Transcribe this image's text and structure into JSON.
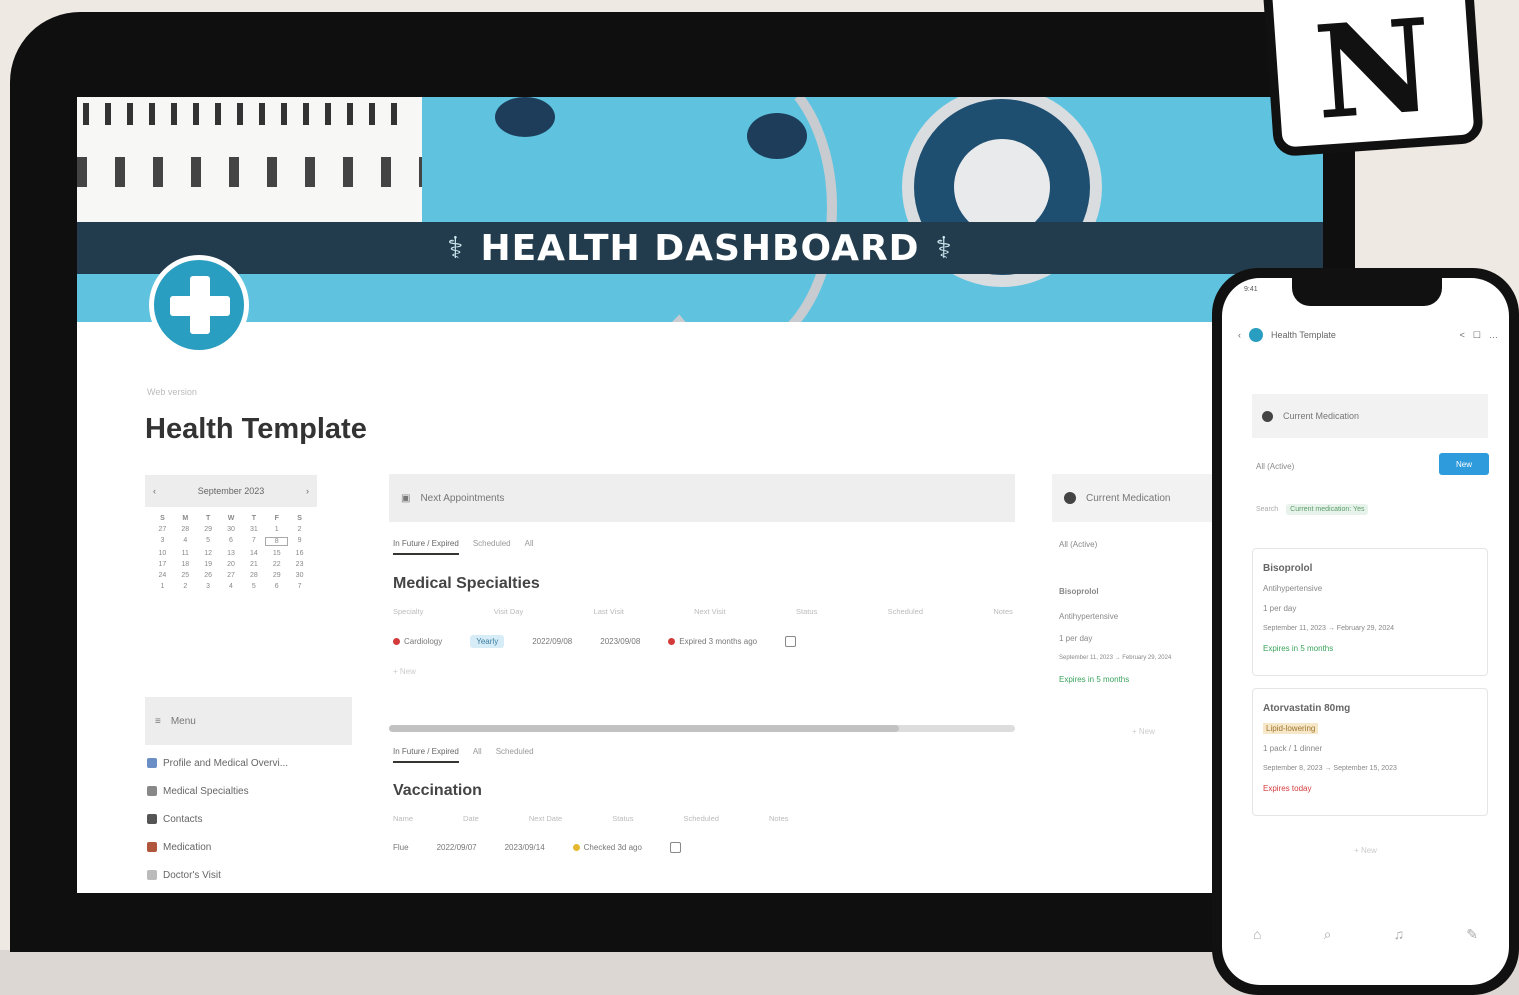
{
  "banner": {
    "title": "HEALTH DASHBOARD"
  },
  "breadcrumb": "Web version",
  "page_title": "Health Template",
  "calendar": {
    "month": "September 2023",
    "weekdays": [
      "S",
      "M",
      "T",
      "W",
      "T",
      "F",
      "S"
    ],
    "days": [
      "27",
      "28",
      "29",
      "30",
      "31",
      "1",
      "2",
      "3",
      "4",
      "5",
      "6",
      "7",
      "8",
      "9",
      "10",
      "11",
      "12",
      "13",
      "14",
      "15",
      "16",
      "17",
      "18",
      "19",
      "20",
      "21",
      "22",
      "23",
      "24",
      "25",
      "26",
      "27",
      "28",
      "29",
      "30",
      "1",
      "2",
      "3",
      "4",
      "5",
      "6",
      "7"
    ]
  },
  "menu": {
    "title": "Menu",
    "items": [
      "Profile and Medical Overvi...",
      "Medical Specialties",
      "Contacts",
      "Medication",
      "Doctor's Visit"
    ]
  },
  "appointments": {
    "title": "Next Appointments"
  },
  "medical": {
    "tabs": [
      "In Future / Expired",
      "Scheduled",
      "All"
    ],
    "title": "Medical Specialties",
    "props": [
      "Specialty",
      "Visit Day",
      "Last Visit",
      "Next Visit",
      "Status",
      "Scheduled",
      "Notes"
    ],
    "row": {
      "name": "Cardiology",
      "tag": "Yearly",
      "last": "2022/09/08",
      "next": "2023/09/08",
      "status": "Expired 3 months ago"
    },
    "new_label": "+ New"
  },
  "vaccination": {
    "tabs": [
      "In Future / Expired",
      "All",
      "Scheduled"
    ],
    "title": "Vaccination",
    "props": [
      "Name",
      "Date",
      "Next Date",
      "Status",
      "Scheduled",
      "Notes"
    ],
    "row": {
      "name": "Flue",
      "date": "2022/09/07",
      "next": "2023/09/14",
      "status": "Checked 3d ago"
    }
  },
  "medication": {
    "title": "Current Medication",
    "view": "All (Active)",
    "item": "Bisoprolol",
    "type": "Antihypertensive",
    "dose": "1 per day",
    "dates": "September 11, 2023 → February 29, 2024",
    "status": "Expires in 5 months",
    "new_label": "+ New"
  },
  "phone": {
    "time": "9:41",
    "nav_title": "Health Template",
    "medication_title": "Current Medication",
    "view": "All (Active)",
    "new_button": "New",
    "search_label": "Search",
    "search_chip": "Current medication: Yes",
    "cards": [
      {
        "title": "Bisoprolol",
        "tag": "Antihypertensive",
        "dose": "1 per day",
        "dates": "September 11, 2023 → February 29, 2024",
        "status": "Expires in 5 months"
      },
      {
        "title": "Atorvastatin 80mg",
        "tag": "Lipid-lowering",
        "dose": "1 pack / 1 dinner",
        "dates": "September 8, 2023 → September 15, 2023",
        "status": "Expires today"
      }
    ],
    "new_label": "+ New"
  },
  "colors": {
    "accent": "#2a9ec0",
    "banner": "#223b4d",
    "cover": "#5fc3df",
    "expired": "#d33b3b",
    "ok": "#3aa35c"
  },
  "icons": [
    "notion-logo",
    "plus-medical-icon",
    "stethoscope-icon",
    "calendar-icon",
    "search-icon",
    "bell-icon"
  ]
}
